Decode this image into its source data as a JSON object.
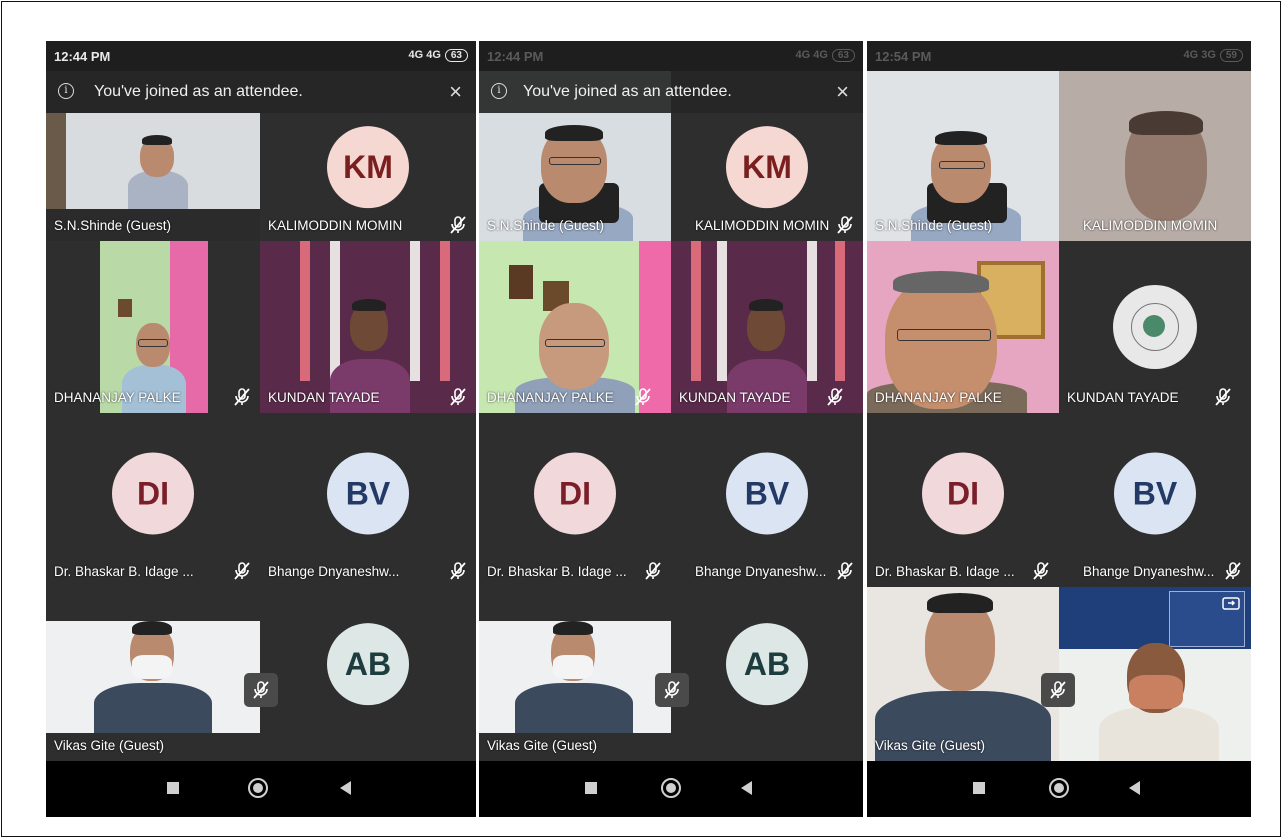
{
  "banner": {
    "message": "You've joined as an attendee.",
    "close": "×",
    "info": "i"
  },
  "phones": [
    {
      "time": "12:44 PM",
      "signal": "4G 4G",
      "battery": "63"
    },
    {
      "time": "12:44 PM",
      "signal": "4G 4G",
      "battery": "63"
    },
    {
      "time": "12:54 PM",
      "signal": "4G 3G",
      "battery": "59"
    }
  ],
  "participants": {
    "sn": "S.N.Shinde (Guest)",
    "km": "KALIMODDIN MOMIN",
    "dp": "DHANANJAY PALKE",
    "kt": "KUNDAN TAYADE",
    "bi": "Dr. Bhaskar B. Idage ...",
    "bd": "Bhange Dnyaneshw...",
    "vg": "Vikas Gite (Guest)"
  },
  "avatars": {
    "km": "KM",
    "di": "DI",
    "bv": "BV",
    "ab": "AB"
  },
  "colors": {
    "tile_bg": "#2e2e2e",
    "status_bar": "#1e1e1e",
    "nav_bar": "#000000"
  },
  "icons": [
    "info-icon",
    "close-icon",
    "mic-off-icon",
    "recents-square-icon",
    "home-circle-icon",
    "back-triangle-icon",
    "switch-camera-icon"
  ]
}
